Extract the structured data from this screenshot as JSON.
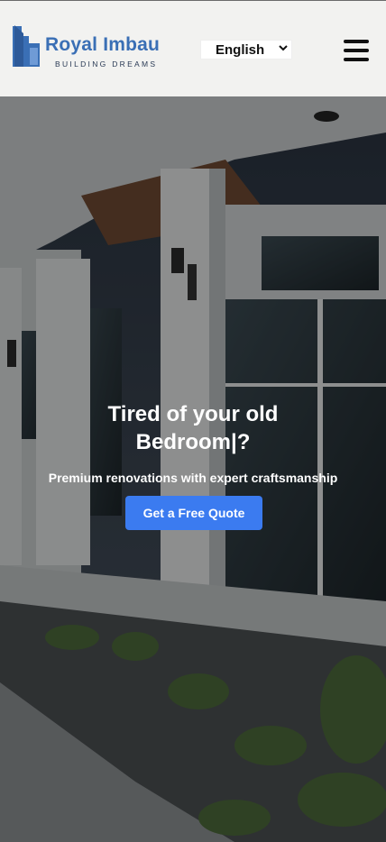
{
  "colors": {
    "header_bg": "#f2f2f0",
    "brand_blue": "#3a6fb5",
    "cta_blue": "#3b7bf0"
  },
  "header": {
    "logo": {
      "name": "Royal Imbau",
      "tagline": "BUILDING DREAMS",
      "icon": "building-logo-icon"
    },
    "language_select": {
      "selected": "English",
      "icon": "chevron-down-icon"
    },
    "menu_icon": "hamburger-menu-icon"
  },
  "hero": {
    "title_line1": "Tired of your old",
    "title_line2": "Bedroom|?",
    "subtitle": "Premium renovations with expert craftsmanship",
    "cta_label": "Get a Free Quote"
  }
}
